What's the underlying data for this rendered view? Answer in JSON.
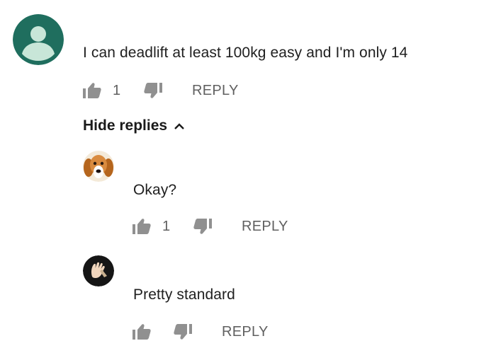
{
  "comment": {
    "text": "I can deadlift at least 100kg easy and I'm only 14",
    "like_count": "1",
    "reply_label": "REPLY",
    "avatar_color": "#1f6e5e"
  },
  "replies_toggle": {
    "label": "Hide replies",
    "icon": "chevron-up-icon"
  },
  "replies": [
    {
      "text": "Okay?",
      "like_count": "1",
      "reply_label": "REPLY",
      "avatar": "dog-avatar"
    },
    {
      "text": "Pretty standard",
      "like_count": "",
      "reply_label": "REPLY",
      "avatar": "hand-avatar"
    }
  ],
  "colors": {
    "text": "#202020",
    "secondary": "#606060",
    "icon": "#909090"
  }
}
